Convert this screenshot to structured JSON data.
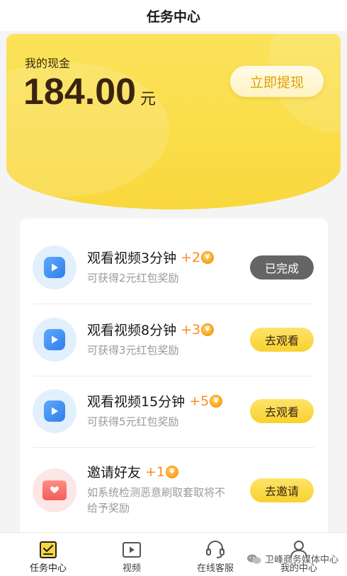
{
  "header": {
    "title": "任务中心"
  },
  "cash": {
    "label": "我的现金",
    "amount": "184.00",
    "unit": "元",
    "withdraw_label": "立即提现"
  },
  "tasks": [
    {
      "title": "观看视频3分钟",
      "reward": "+2",
      "coin": "¥",
      "desc": "可获得2元红包奖励",
      "action": "已完成",
      "state": "done",
      "icon": "play-icon"
    },
    {
      "title": "观看视频8分钟",
      "reward": "+3",
      "coin": "¥",
      "desc": "可获得3元红包奖励",
      "action": "去观看",
      "state": "go",
      "icon": "play-icon"
    },
    {
      "title": "观看视频15分钟",
      "reward": "+5",
      "coin": "¥",
      "desc": "可获得5元红包奖励",
      "action": "去观看",
      "state": "go",
      "icon": "play-icon"
    },
    {
      "title": "邀请好友",
      "reward": "+1",
      "coin": "¥",
      "desc_line1": "如系统检测恶意刷取套取将不",
      "desc_line2": "给予奖励",
      "action": "去邀请",
      "state": "go",
      "icon": "invite-mail-icon"
    }
  ],
  "tabbar": {
    "items": [
      {
        "label": "任务中心",
        "icon": "task-icon",
        "active": true
      },
      {
        "label": "视频",
        "icon": "video-icon",
        "active": false
      },
      {
        "label": "在线客服",
        "icon": "headset-icon",
        "active": false
      },
      {
        "label": "我的中心",
        "icon": "user-icon",
        "active": false
      }
    ]
  },
  "watermark": {
    "text": "卫峰商务媒体中心"
  },
  "colors": {
    "accent_yellow": "#f9d83d",
    "reward_orange": "#ff8a1f",
    "withdraw_text": "#e0a000",
    "done_gray": "#656565",
    "play_blue": "#2f7fe8"
  }
}
